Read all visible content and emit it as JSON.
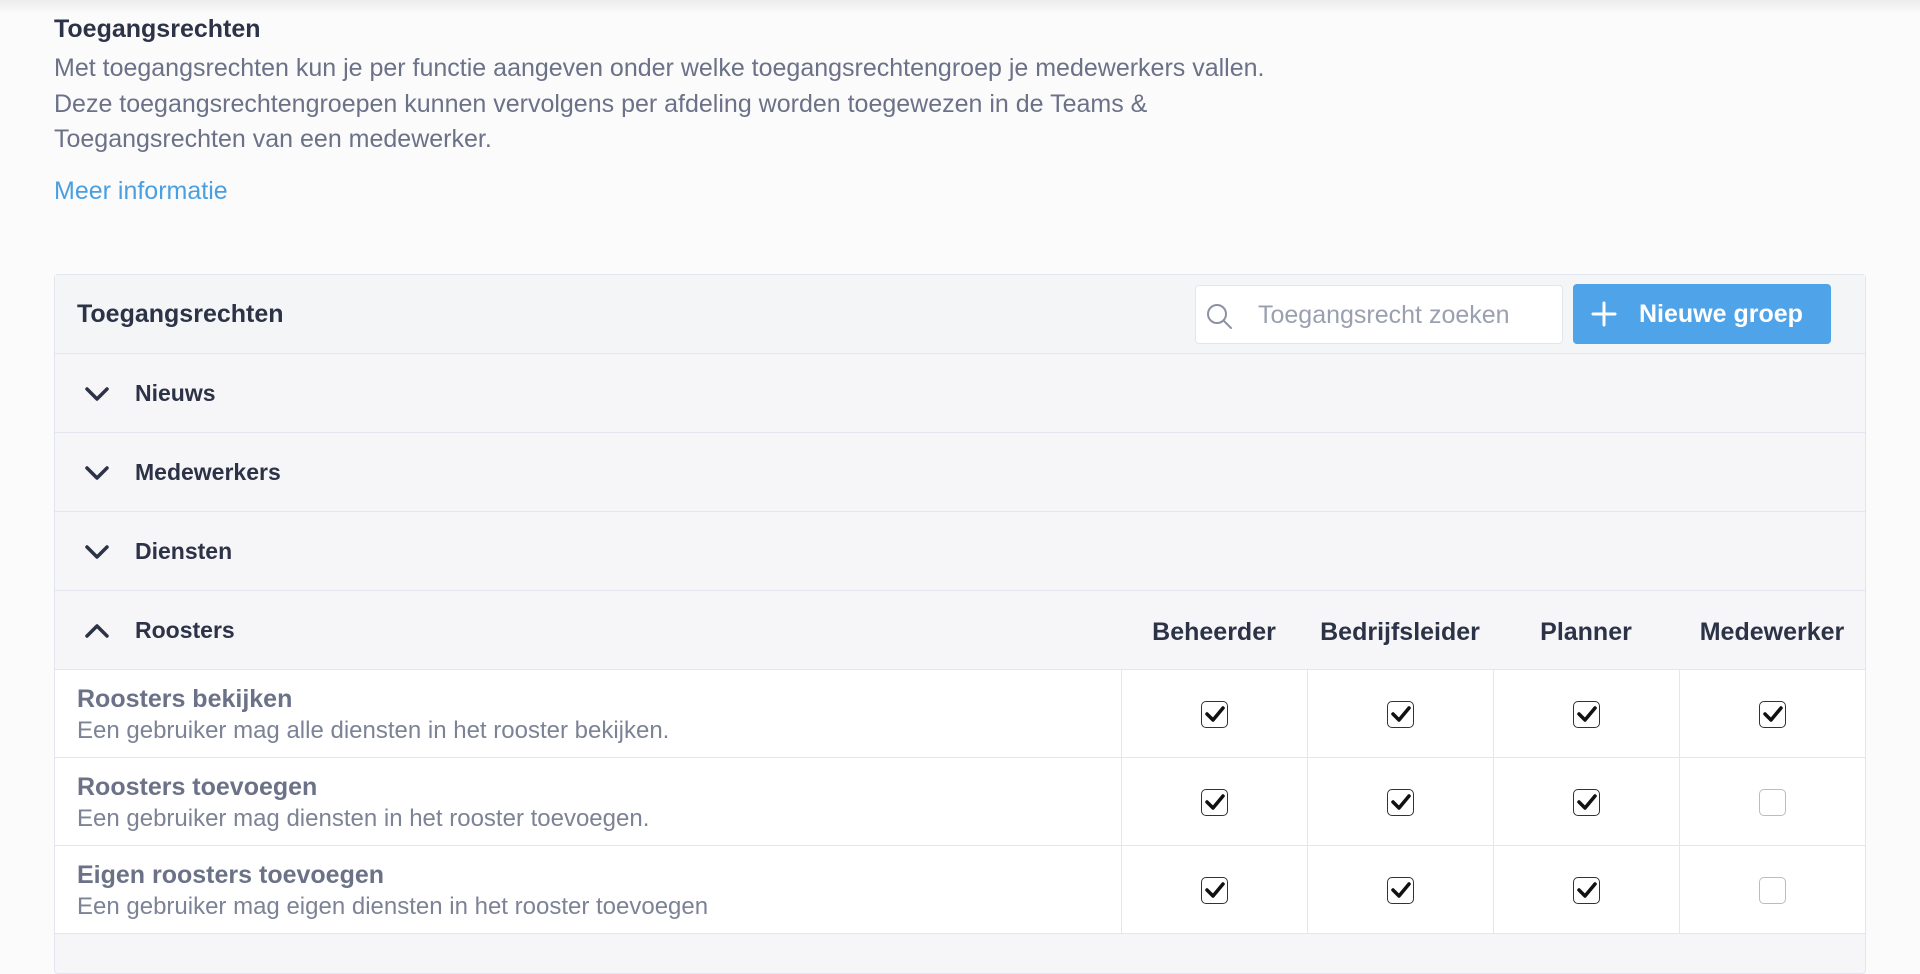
{
  "intro": {
    "title": "Toegangsrechten",
    "description": "Met toegangsrechten kun je per functie aangeven onder welke toegangsrechtengroep je medewerkers vallen. Deze toegangsrechtengroepen kunnen vervolgens per afdeling worden toegewezen in de Teams & Toegangsrechten van een medewerker.",
    "link": "Meer informatie"
  },
  "panel": {
    "title": "Toegangsrechten",
    "search_placeholder": "Toegangsrecht zoeken",
    "new_group_label": "Nieuwe groep"
  },
  "sections": [
    {
      "label": "Nieuws",
      "expanded": false
    },
    {
      "label": "Medewerkers",
      "expanded": false
    },
    {
      "label": "Diensten",
      "expanded": false
    },
    {
      "label": "Roosters",
      "expanded": true
    }
  ],
  "columns": [
    "Beheerder",
    "Bedrijfsleider",
    "Planner",
    "Medewerker"
  ],
  "rows": [
    {
      "title": "Roosters bekijken",
      "description": "Een gebruiker mag alle diensten in het rooster bekijken.",
      "checks": [
        true,
        true,
        true,
        true
      ]
    },
    {
      "title": "Roosters toevoegen",
      "description": "Een gebruiker mag diensten in het rooster toevoegen.",
      "checks": [
        true,
        true,
        true,
        false
      ]
    },
    {
      "title": "Eigen roosters toevoegen",
      "description": "Een gebruiker mag eigen diensten in het rooster toevoegen",
      "checks": [
        true,
        true,
        true,
        false
      ]
    }
  ],
  "colors": {
    "accent": "#4fa3e8",
    "link": "#4a9fe0",
    "text": "#2d3347",
    "muted": "#6b7287"
  }
}
